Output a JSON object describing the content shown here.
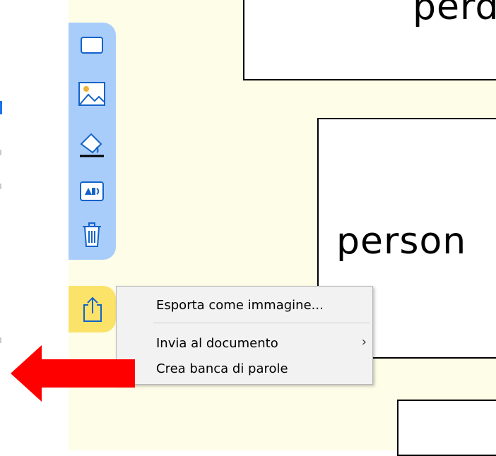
{
  "canvas": {
    "background": "#fefde8",
    "cards": [
      {
        "word": "perd"
      },
      {
        "word": ""
      },
      {
        "word": "person"
      },
      {
        "word": ""
      }
    ]
  },
  "toolbar": {
    "background": "#a9cdfb",
    "tools": [
      {
        "icon": "rectangle-icon"
      },
      {
        "icon": "image-icon"
      },
      {
        "icon": "fill-color-icon"
      },
      {
        "icon": "text-to-speech-icon"
      },
      {
        "icon": "trash-icon"
      }
    ]
  },
  "export_button": {
    "icon": "share-export-icon",
    "background": "#fbe36a"
  },
  "context_menu": {
    "items": [
      {
        "label": "Esporta come immagine..."
      },
      {
        "label": "Invia al documento",
        "submenu_glyph": "›"
      },
      {
        "label": "Crea banca di parole"
      }
    ]
  },
  "annotation": {
    "icon": "red-arrow-icon",
    "color": "#ff0000"
  }
}
